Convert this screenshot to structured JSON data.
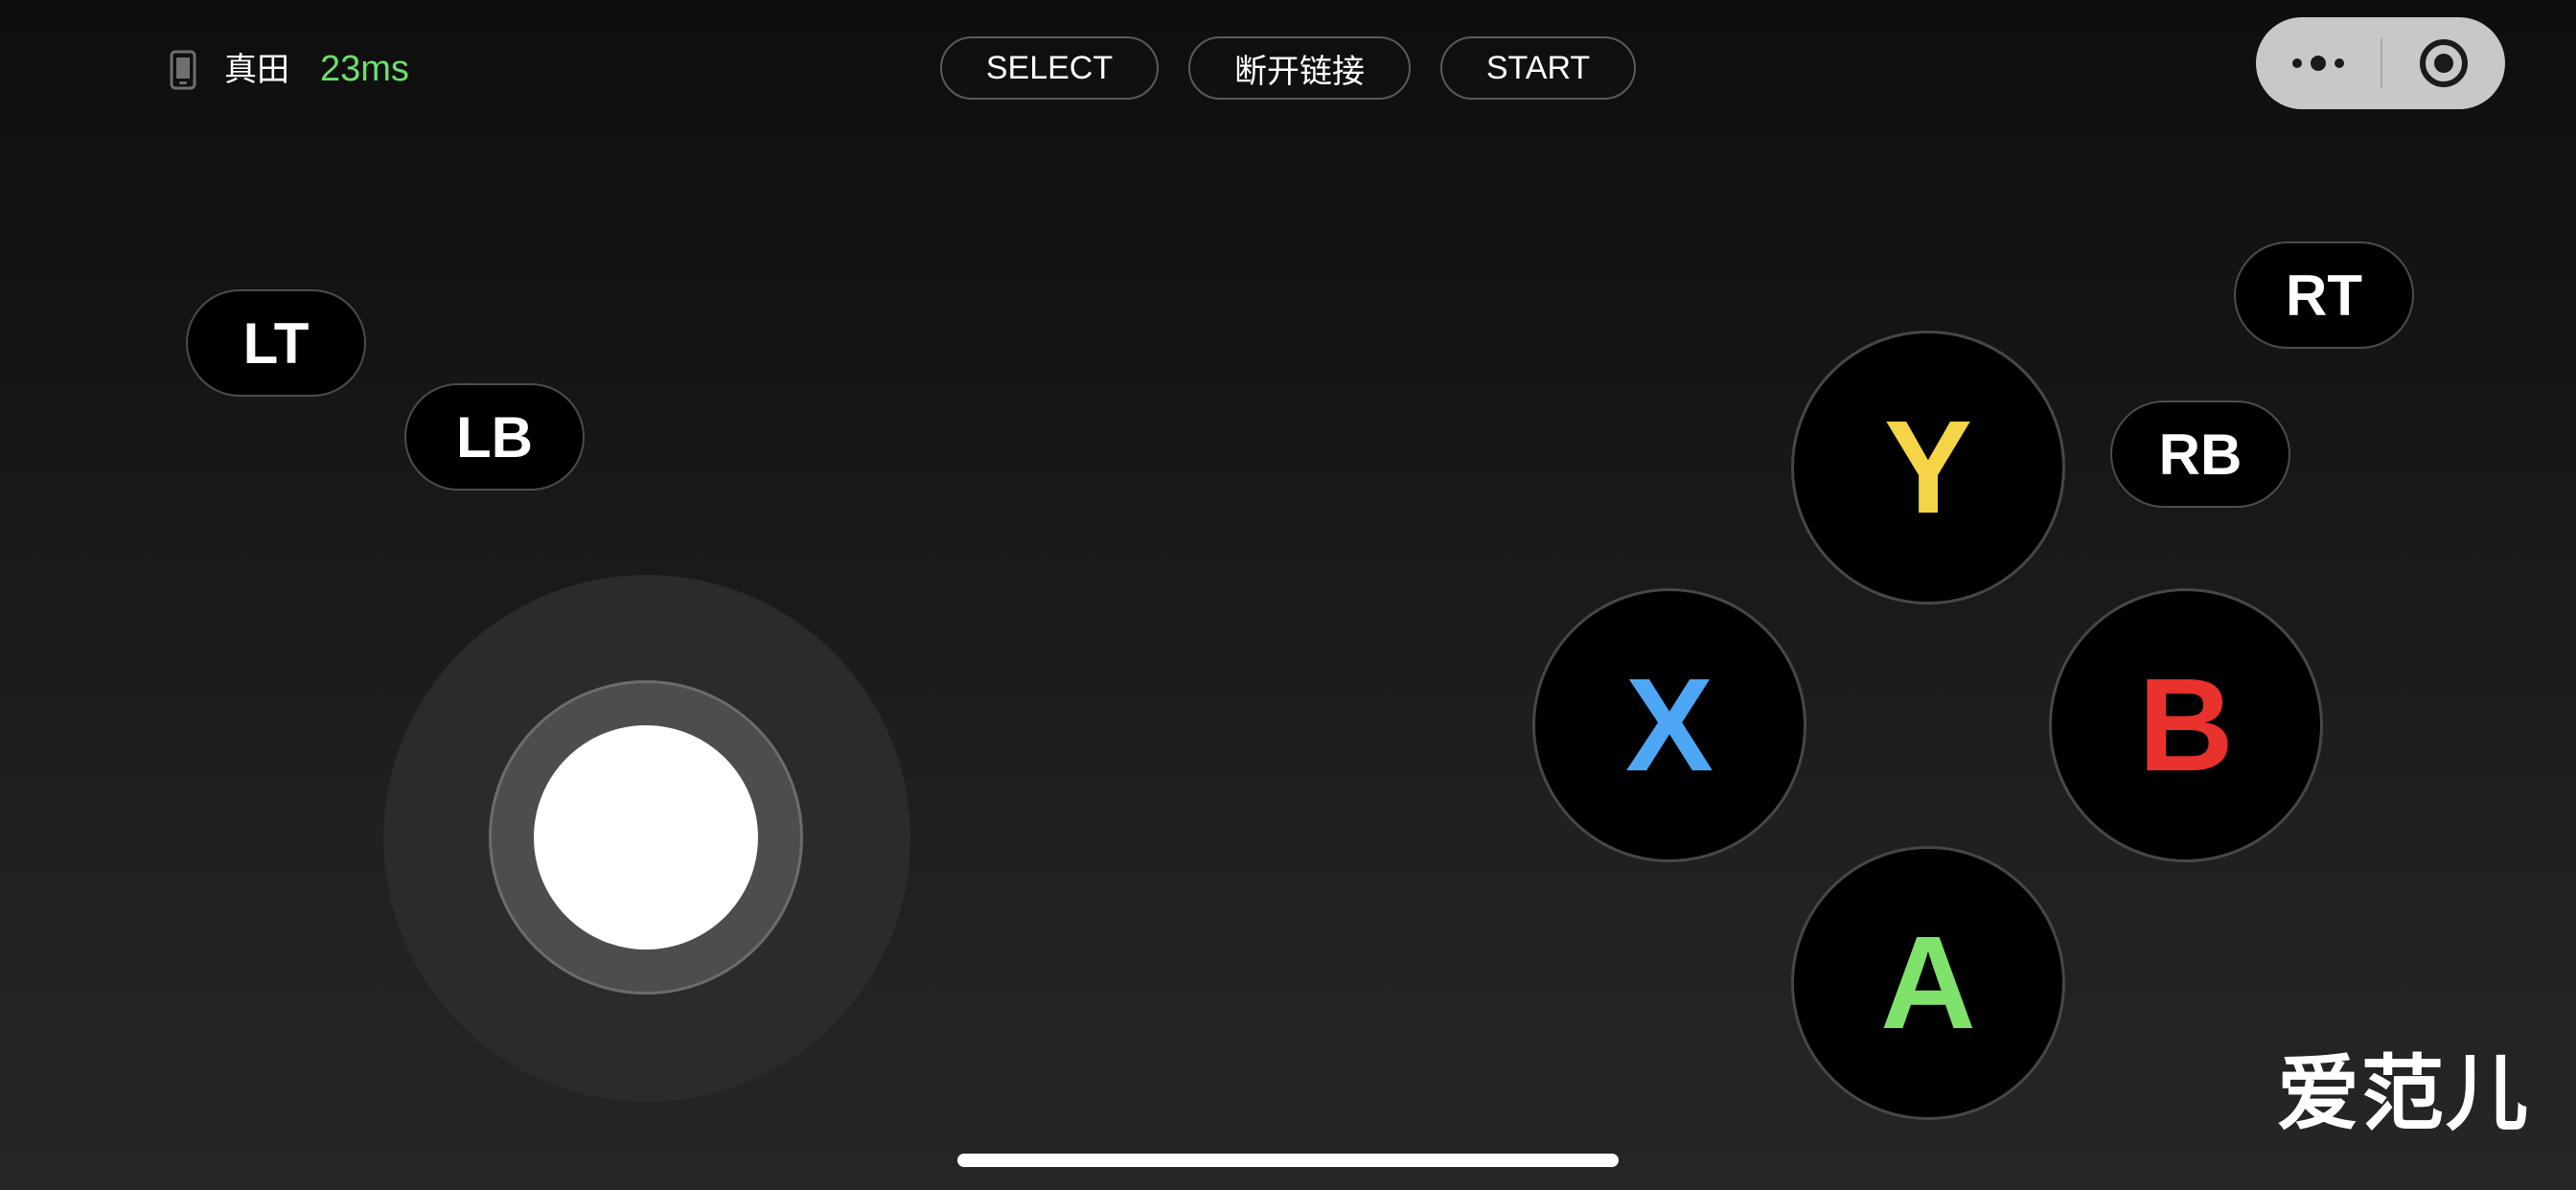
{
  "status": {
    "device_icon": "phone-icon",
    "device_name": "真田",
    "latency": "23ms",
    "latency_color": "#6be06a"
  },
  "toolbar": {
    "select_label": "SELECT",
    "disconnect_label": "断开链接",
    "start_label": "START"
  },
  "capsule": {
    "more_icon": "more-dots-icon",
    "close_icon": "target-circle-icon"
  },
  "shoulders": {
    "lt": "LT",
    "lb": "LB",
    "rt": "RT",
    "rb": "RB"
  },
  "joystick": {
    "icon": "joystick-knob"
  },
  "face_buttons": {
    "y": {
      "label": "Y",
      "color": "#f5d547"
    },
    "x": {
      "label": "X",
      "color": "#4ea7f5"
    },
    "b": {
      "label": "B",
      "color": "#e8322b"
    },
    "a": {
      "label": "A",
      "color": "#7fe36b"
    }
  },
  "watermark": "爱范儿"
}
